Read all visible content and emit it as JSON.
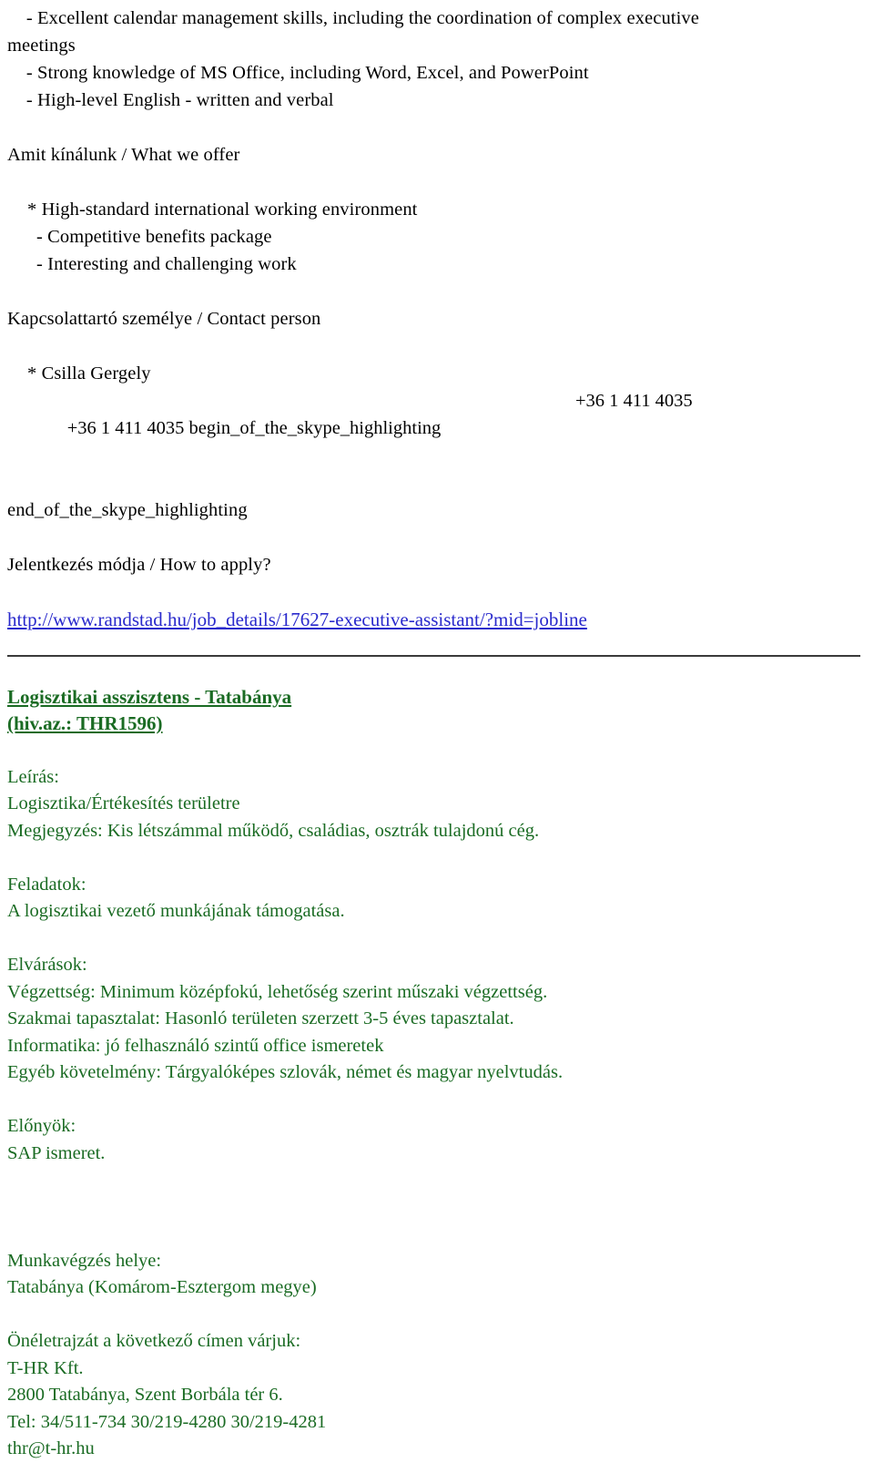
{
  "document": {
    "type": "job-posting",
    "colors": {
      "body_text": "#000000",
      "link": "#2929cc",
      "green_section": "#1a6b23",
      "divider": "#3a3a3a",
      "background": "#ffffff"
    }
  },
  "requirements_tail": {
    "line1": "    - Excellent calendar management skills, including the coordination of complex executive",
    "line2": "meetings",
    "line3": "    - Strong knowledge of MS Office, including Word, Excel, and PowerPoint",
    "line4": "    - High-level English - written and verbal"
  },
  "offer": {
    "heading": "Amit kínálunk / What we offer",
    "items": [
      "* High-standard international working environment",
      "- Competitive benefits package",
      "- Interesting and challenging work"
    ]
  },
  "contact": {
    "heading": "Kapcsolattartó személye / Contact person",
    "name": "* Csilla Gergely",
    "phone_primary": "+36 1 411 4035 begin_of_the_skype_highlighting",
    "phone_secondary": "+36 1 411 4035",
    "skype_end_marker": "end_of_the_skype_highlighting"
  },
  "apply": {
    "heading": "Jelentkezés módja / How to apply?",
    "url": "http://www.randstad.hu/job_details/17627-executive-assistant/?mid=jobline"
  },
  "job": {
    "title_line1": "Logisztikai asszisztens - Tatabánya",
    "title_line2": "(hiv.az.: THR1596)",
    "description": {
      "label": "Leírás:",
      "line1": "Logisztika/Értékesítés területre",
      "line2": "Megjegyzés: Kis létszámmal működő, családias, osztrák tulajdonú cég."
    },
    "tasks": {
      "label": "Feladatok:",
      "line1": "A logisztikai vezető munkájának támogatása."
    },
    "expectations": {
      "label": "Elvárások:",
      "line1": "Végzettség: Minimum középfokú, lehetőség szerint műszaki végzettség.",
      "line2": "Szakmai tapasztalat: Hasonló területen szerzett 3-5 éves tapasztalat.",
      "line3": "Informatika: jó felhasználó szintű office ismeretek",
      "line4": "Egyéb követelmény: Tárgyalóképes szlovák, német és magyar nyelvtudás."
    },
    "advantages": {
      "label": "Előnyök:",
      "line1": "SAP ismeret."
    },
    "location": {
      "label": "Munkavégzés helye:",
      "line1": "Tatabánya (Komárom-Esztergom megye)"
    },
    "application": {
      "label": "Önéletrajzát a következő címen várjuk:",
      "company": "T-HR Kft.",
      "address": "2800 Tatabánya, Szent Borbála tér 6.",
      "phone": "Tel: 34/511-734 30/219-4280 30/219-4281",
      "email": "thr@t-hr.hu"
    }
  }
}
